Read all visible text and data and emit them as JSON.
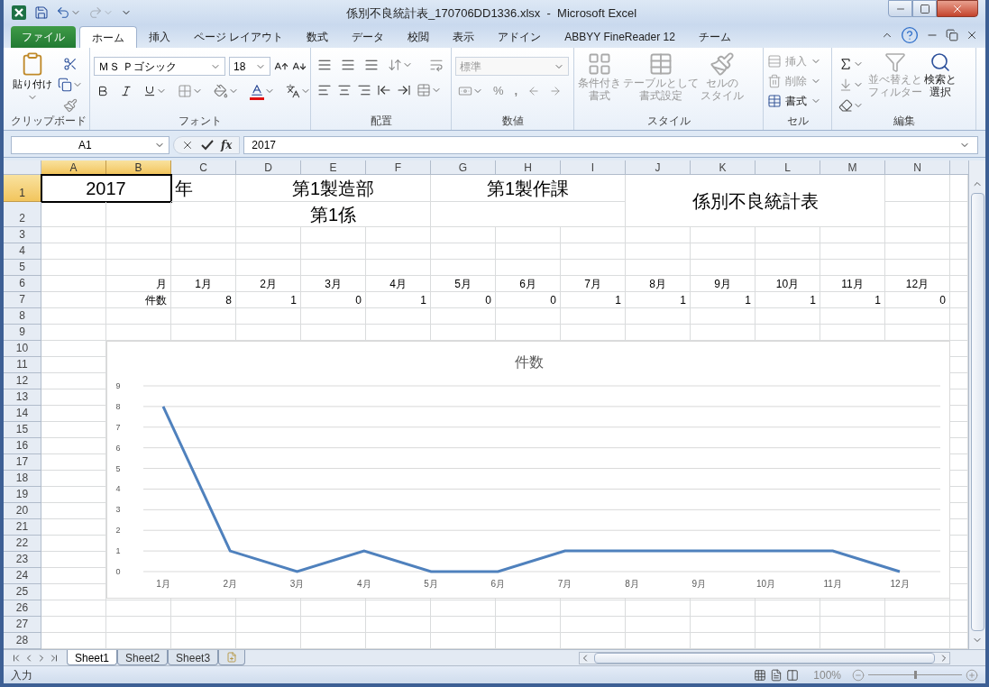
{
  "window": {
    "title": "係別不良統計表_170706DD1336.xlsx  -  Microsoft Excel"
  },
  "ribbon_tabs": [
    {
      "label": "ファイル",
      "kind": "file",
      "selected": false
    },
    {
      "label": "ホーム",
      "kind": "tab",
      "selected": true
    },
    {
      "label": "挿入",
      "kind": "tab",
      "selected": false
    },
    {
      "label": "ページ レイアウト",
      "kind": "tab",
      "selected": false
    },
    {
      "label": "数式",
      "kind": "tab",
      "selected": false
    },
    {
      "label": "データ",
      "kind": "tab",
      "selected": false
    },
    {
      "label": "校閲",
      "kind": "tab",
      "selected": false
    },
    {
      "label": "表示",
      "kind": "tab",
      "selected": false
    },
    {
      "label": "アドイン",
      "kind": "tab",
      "selected": false
    },
    {
      "label": "ABBYY FineReader 12",
      "kind": "tab",
      "selected": false
    },
    {
      "label": "チーム",
      "kind": "tab",
      "selected": false
    }
  ],
  "clipboard": {
    "label": "クリップボード",
    "paste": "貼り付け"
  },
  "font": {
    "label": "フォント",
    "name": "ＭＳ Ｐゴシック",
    "size": "18"
  },
  "alignment": {
    "label": "配置"
  },
  "number": {
    "label": "数値",
    "format": "標準",
    "percent": "%",
    "comma": ","
  },
  "styles": {
    "label": "スタイル",
    "buttons": [
      {
        "lines": [
          "条件付き",
          "書式"
        ],
        "disabled": true
      },
      {
        "lines": [
          "テーブルとして",
          "書式設定"
        ],
        "disabled": true
      },
      {
        "lines": [
          "セルの",
          "スタイル"
        ],
        "disabled": true
      }
    ]
  },
  "cells": {
    "label": "セル",
    "buttons": [
      {
        "label": "挿入",
        "disabled": true
      },
      {
        "label": "削除",
        "disabled": true
      },
      {
        "label": "書式",
        "disabled": false
      }
    ]
  },
  "editing": {
    "label": "編集",
    "buttons": [
      {
        "lines": [
          "並べ替えと",
          "フィルター"
        ],
        "disabled": true
      },
      {
        "lines": [
          "検索と",
          "選択"
        ],
        "disabled": false
      }
    ]
  },
  "formula_bar": {
    "name_box": "A1",
    "function_label": "fx",
    "formula": "2017"
  },
  "columns": [
    {
      "label": "A",
      "selected": true
    },
    {
      "label": "B",
      "selected": true
    },
    {
      "label": "C",
      "selected": false
    },
    {
      "label": "D",
      "selected": false
    },
    {
      "label": "E",
      "selected": false
    },
    {
      "label": "F",
      "selected": false
    },
    {
      "label": "G",
      "selected": false
    },
    {
      "label": "H",
      "selected": false
    },
    {
      "label": "I",
      "selected": false
    },
    {
      "label": "J",
      "selected": false
    },
    {
      "label": "K",
      "selected": false
    },
    {
      "label": "L",
      "selected": false
    },
    {
      "label": "M",
      "selected": false
    },
    {
      "label": "N",
      "selected": false
    }
  ],
  "rows": [
    {
      "label": "1",
      "selected": true
    },
    {
      "label": "2",
      "selected": false
    },
    {
      "label": "3",
      "selected": false
    },
    {
      "label": "4",
      "selected": false
    },
    {
      "label": "5",
      "selected": false
    },
    {
      "label": "6",
      "selected": false
    },
    {
      "label": "7",
      "selected": false
    },
    {
      "label": "8",
      "selected": false
    },
    {
      "label": "9",
      "selected": false
    },
    {
      "label": "10",
      "selected": false
    },
    {
      "label": "11",
      "selected": false
    },
    {
      "label": "12",
      "selected": false
    },
    {
      "label": "13",
      "selected": false
    },
    {
      "label": "14",
      "selected": false
    },
    {
      "label": "15",
      "selected": false
    },
    {
      "label": "16",
      "selected": false
    },
    {
      "label": "17",
      "selected": false
    },
    {
      "label": "18",
      "selected": false
    },
    {
      "label": "19",
      "selected": false
    },
    {
      "label": "20",
      "selected": false
    },
    {
      "label": "21",
      "selected": false
    },
    {
      "label": "22",
      "selected": false
    },
    {
      "label": "23",
      "selected": false
    },
    {
      "label": "24",
      "selected": false
    },
    {
      "label": "25",
      "selected": false
    },
    {
      "label": "26",
      "selected": false
    },
    {
      "label": "27",
      "selected": false
    },
    {
      "label": "28",
      "selected": false
    }
  ],
  "header_block": {
    "year": "2017",
    "year_suffix": "年",
    "department": "第1製造部",
    "section": "第1係",
    "division": "第1製作課",
    "title": "係別不良統計表"
  },
  "table": {
    "month_label": "月",
    "count_label": "件数",
    "months": [
      "1月",
      "2月",
      "3月",
      "4月",
      "5月",
      "6月",
      "7月",
      "8月",
      "9月",
      "10月",
      "11月",
      "12月"
    ],
    "counts": [
      "8",
      "1",
      "0",
      "1",
      "0",
      "0",
      "1",
      "1",
      "1",
      "1",
      "1",
      "0"
    ]
  },
  "chart": {
    "chart_data": {
      "type": "line",
      "grid": true,
      "categories": [
        "1月",
        "2月",
        "3月",
        "4月",
        "5月",
        "6月",
        "7月",
        "8月",
        "9月",
        "10月",
        "11月",
        "12月"
      ],
      "series": [
        {
          "name": "件数",
          "color": "#4f81bd",
          "values": [
            8,
            1,
            0,
            1,
            0,
            0,
            1,
            1,
            1,
            1,
            1,
            0
          ]
        }
      ],
      "ylim": [
        0,
        9
      ],
      "yticks": [
        0,
        1,
        2,
        3,
        4,
        5,
        6,
        7,
        8,
        9
      ]
    }
  },
  "sheet_tabs": [
    {
      "label": "Sheet1",
      "selected": true
    },
    {
      "label": "Sheet2",
      "selected": false
    },
    {
      "label": "Sheet3",
      "selected": false
    }
  ],
  "status_bar": {
    "mode": "入力",
    "zoom": "100%",
    "zoom_slider": {
      "level": 0.5
    }
  }
}
